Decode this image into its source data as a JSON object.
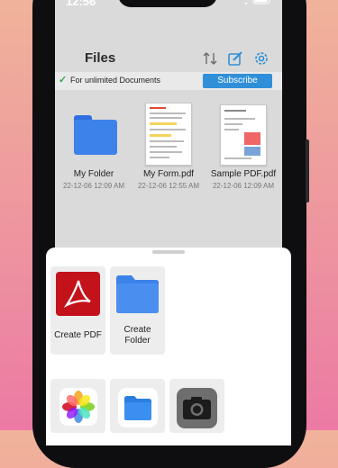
{
  "status": {
    "time": "12:56"
  },
  "header": {
    "title": "Files"
  },
  "promo": {
    "text": "For unlimited Documents",
    "button": "Subscribe"
  },
  "files": [
    {
      "name": "My Folder",
      "date": "22-12-06 12:09 AM",
      "icon": "folder-icon"
    },
    {
      "name": "My Form.pdf",
      "date": "22-12-06 12:55 AM",
      "icon": "pdf-thumbnail"
    },
    {
      "name": "Sample PDF.pdf",
      "date": "22-12-06 12:09 AM",
      "icon": "pdf-thumbnail"
    }
  ],
  "sheet": {
    "actions": [
      {
        "label": "Create PDF",
        "icon": "acrobat-icon"
      },
      {
        "label": "Create Folder",
        "icon": "folder-icon"
      }
    ],
    "sources": [
      {
        "icon": "photos-icon"
      },
      {
        "icon": "files-icon"
      },
      {
        "icon": "camera-icon"
      }
    ]
  },
  "colors": {
    "accent": "#2f8fd8",
    "folder": "#3d82ea",
    "acrobat": "#c4121b"
  }
}
